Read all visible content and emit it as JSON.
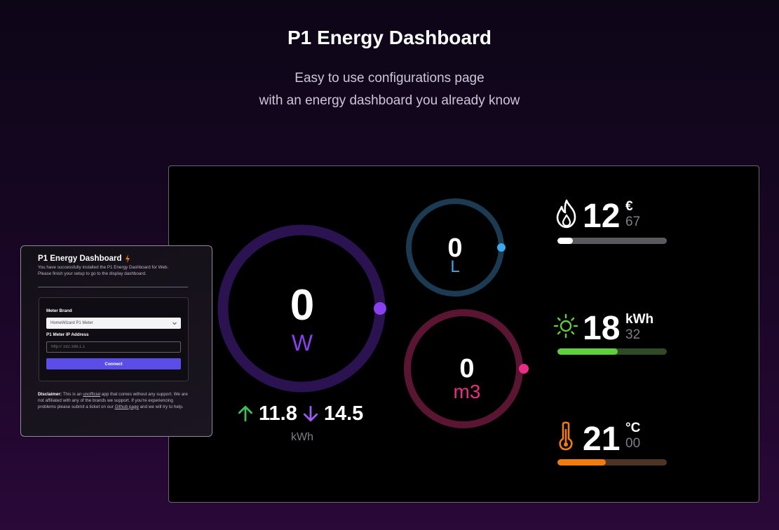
{
  "hero": {
    "title": "P1 Energy Dashboard",
    "subtitle_line1": "Easy to use configurations page",
    "subtitle_line2": "with an energy dashboard you already know"
  },
  "dashboard": {
    "power": {
      "value": "0",
      "unit": "W",
      "color": "#8a3ff0"
    },
    "water": {
      "value": "0",
      "unit": "L",
      "color": "#3aa8ee"
    },
    "gas": {
      "value": "0",
      "unit": "m3",
      "color": "#ea2d84"
    },
    "energy": {
      "import": "11.8",
      "export": "14.5",
      "unit": "kWh"
    },
    "stats": [
      {
        "icon": "flame-icon",
        "value": "12",
        "unit": "€",
        "sub": "67",
        "fraction": 0.14,
        "color": "#ffffff",
        "track": "#5a5a5e"
      },
      {
        "icon": "sun-icon",
        "value": "18",
        "unit": "kWh",
        "sub": "32",
        "fraction": 0.55,
        "color": "#5ed13a",
        "track": "#2e4a26"
      },
      {
        "icon": "thermometer-icon",
        "value": "21",
        "unit": "°C",
        "sub": "00",
        "fraction": 0.44,
        "color": "#f07b10",
        "track": "#4f3326"
      }
    ]
  },
  "config": {
    "title": "P1 Energy Dashboard",
    "desc_line1": "You have successfully installed the P1 Energy Dashboard for Web.",
    "desc_line2": "Please finish your setup to go to the display dashboard.",
    "meter_brand_label": "Meter Brand",
    "meter_brand_value": "HomeWizard P1 Meter",
    "ip_label": "P1 Meter IP Address",
    "ip_placeholder": "http:// 192.168.1.1",
    "connect_label": "Connect",
    "disclaimer_bold": "Disclaimer:",
    "disclaimer_pre": " This is an ",
    "disclaimer_unofficial": "unofficial",
    "disclaimer_mid": " app that comes without any support. We are not affiliated with any of the brands we support. If you're experiencing problems please submit a ticket on our ",
    "disclaimer_link": "Github page",
    "disclaimer_post": " and we will try to help."
  }
}
